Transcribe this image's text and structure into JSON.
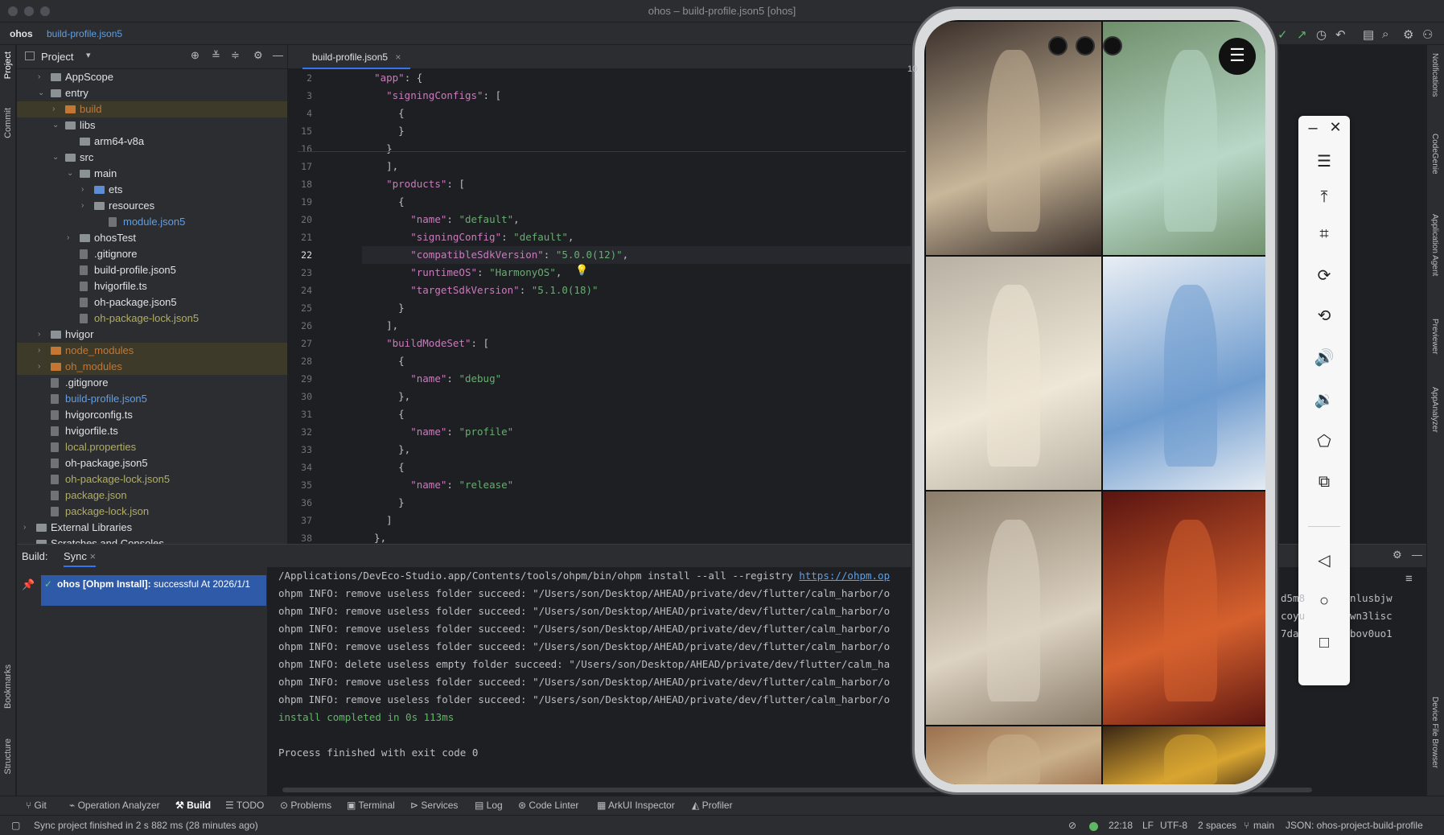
{
  "window": {
    "title": "ohos – build-profile.json5 [ohos]"
  },
  "nav": {
    "project": "ohos",
    "file": "build-profile.json5"
  },
  "project_panel": {
    "title": "Project",
    "tree": [
      {
        "label": "AppScope",
        "type": "folder",
        "depth": 1,
        "arrow": "›",
        "color": "def"
      },
      {
        "label": "entry",
        "type": "folder",
        "depth": 1,
        "arrow": "⌄",
        "color": "def"
      },
      {
        "label": "build",
        "type": "folder-orange",
        "depth": 2,
        "arrow": "›",
        "color": "orange",
        "hl": true
      },
      {
        "label": "libs",
        "type": "folder",
        "depth": 2,
        "arrow": "⌄",
        "color": "def"
      },
      {
        "label": "arm64-v8a",
        "type": "folder",
        "depth": 3,
        "arrow": "",
        "color": "def"
      },
      {
        "label": "src",
        "type": "folder",
        "depth": 2,
        "arrow": "⌄",
        "color": "def"
      },
      {
        "label": "main",
        "type": "folder",
        "depth": 3,
        "arrow": "⌄",
        "color": "def"
      },
      {
        "label": "ets",
        "type": "folder-blue",
        "depth": 4,
        "arrow": "›",
        "color": "def"
      },
      {
        "label": "resources",
        "type": "folder",
        "depth": 4,
        "arrow": "›",
        "color": "def"
      },
      {
        "label": "module.json5",
        "type": "file",
        "depth": 5,
        "arrow": "",
        "color": "blue"
      },
      {
        "label": "ohosTest",
        "type": "folder",
        "depth": 3,
        "arrow": "›",
        "color": "def"
      },
      {
        "label": ".gitignore",
        "type": "file",
        "depth": 3,
        "arrow": "",
        "color": "def"
      },
      {
        "label": "build-profile.json5",
        "type": "file",
        "depth": 3,
        "arrow": "",
        "color": "def"
      },
      {
        "label": "hvigorfile.ts",
        "type": "file",
        "depth": 3,
        "arrow": "",
        "color": "def"
      },
      {
        "label": "oh-package.json5",
        "type": "file",
        "depth": 3,
        "arrow": "",
        "color": "def"
      },
      {
        "label": "oh-package-lock.json5",
        "type": "file",
        "depth": 3,
        "arrow": "",
        "color": "yellow"
      },
      {
        "label": "hvigor",
        "type": "folder",
        "depth": 1,
        "arrow": "›",
        "color": "def"
      },
      {
        "label": "node_modules",
        "type": "folder-orange",
        "depth": 1,
        "arrow": "›",
        "color": "orange",
        "hl": true
      },
      {
        "label": "oh_modules",
        "type": "folder-orange",
        "depth": 1,
        "arrow": "›",
        "color": "orange",
        "hl": true
      },
      {
        "label": ".gitignore",
        "type": "file",
        "depth": 1,
        "arrow": "",
        "color": "def"
      },
      {
        "label": "build-profile.json5",
        "type": "file",
        "depth": 1,
        "arrow": "",
        "color": "blue"
      },
      {
        "label": "hvigorconfig.ts",
        "type": "file",
        "depth": 1,
        "arrow": "",
        "color": "def"
      },
      {
        "label": "hvigorfile.ts",
        "type": "file",
        "depth": 1,
        "arrow": "",
        "color": "def"
      },
      {
        "label": "local.properties",
        "type": "file",
        "depth": 1,
        "arrow": "",
        "color": "yellow"
      },
      {
        "label": "oh-package.json5",
        "type": "file",
        "depth": 1,
        "arrow": "",
        "color": "def"
      },
      {
        "label": "oh-package-lock.json5",
        "type": "file",
        "depth": 1,
        "arrow": "",
        "color": "yellow"
      },
      {
        "label": "package.json",
        "type": "file",
        "depth": 1,
        "arrow": "",
        "color": "yellow"
      },
      {
        "label": "package-lock.json",
        "type": "file",
        "depth": 1,
        "arrow": "",
        "color": "yellow"
      },
      {
        "label": "External Libraries",
        "type": "lib",
        "depth": 0,
        "arrow": "›",
        "color": "def"
      },
      {
        "label": "Scratches and Consoles",
        "type": "lib",
        "depth": 0,
        "arrow": "",
        "color": "def"
      }
    ]
  },
  "editor": {
    "tab": "build-profile.json5",
    "problems": "10",
    "lines": [
      {
        "n": "2",
        "t": "  \"app\": {"
      },
      {
        "n": "3",
        "t": "    \"signingConfigs\": ["
      },
      {
        "n": "4",
        "t": "      {"
      },
      {
        "n": "15",
        "t": "      }"
      },
      {
        "n": "16",
        "t": "    }"
      },
      {
        "n": "17",
        "t": "    ],"
      },
      {
        "n": "18",
        "t": "    \"products\": ["
      },
      {
        "n": "19",
        "t": "      {"
      },
      {
        "n": "20",
        "t": "        \"name\": \"default\","
      },
      {
        "n": "21",
        "t": "        \"signingConfig\": \"default\","
      },
      {
        "n": "22",
        "t": "        \"compatibleSdkVersion\": \"5.0.0(12)\","
      },
      {
        "n": "23",
        "t": "        \"runtimeOS\": \"HarmonyOS\","
      },
      {
        "n": "24",
        "t": "        \"targetSdkVersion\": \"5.1.0(18)\""
      },
      {
        "n": "25",
        "t": "      }"
      },
      {
        "n": "26",
        "t": "    ],"
      },
      {
        "n": "27",
        "t": "    \"buildModeSet\": ["
      },
      {
        "n": "28",
        "t": "      {"
      },
      {
        "n": "29",
        "t": "        \"name\": \"debug\""
      },
      {
        "n": "30",
        "t": "      },"
      },
      {
        "n": "31",
        "t": "      {"
      },
      {
        "n": "32",
        "t": "        \"name\": \"profile\""
      },
      {
        "n": "33",
        "t": "      },"
      },
      {
        "n": "34",
        "t": "      {"
      },
      {
        "n": "35",
        "t": "        \"name\": \"release\""
      },
      {
        "n": "36",
        "t": "      }"
      },
      {
        "n": "37",
        "t": "    ]"
      },
      {
        "n": "38",
        "t": "  },"
      }
    ]
  },
  "build": {
    "label": "Build:",
    "tab": "Sync",
    "entry_bold": "ohos [Ohpm Install]:",
    "entry_rest": "successful At 2026/1/1",
    "console_cmd": "/Applications/DevEco-Studio.app/Contents/tools/ohpm/bin/ohpm install --all --registry ",
    "console_link": "https://ohpm.op",
    "console": [
      "ohpm INFO: remove useless folder succeed: \"/Users/son/Desktop/AHEAD/private/dev/flutter/calm_harbor/o",
      "ohpm INFO: remove useless folder succeed: \"/Users/son/Desktop/AHEAD/private/dev/flutter/calm_harbor/o",
      "ohpm INFO: remove useless folder succeed: \"/Users/son/Desktop/AHEAD/private/dev/flutter/calm_harbor/o",
      "ohpm INFO: remove useless folder succeed: \"/Users/son/Desktop/AHEAD/private/dev/flutter/calm_harbor/o",
      "ohpm INFO: delete useless empty folder succeed: \"/Users/son/Desktop/AHEAD/private/dev/flutter/calm_ha",
      "ohpm INFO: remove useless folder succeed: \"/Users/son/Desktop/AHEAD/private/dev/flutter/calm_harbor/o",
      "ohpm INFO: remove useless folder succeed: \"/Users/son/Desktop/AHEAD/private/dev/flutter/calm_harbor/o"
    ],
    "install_done": "install completed in 0s 113ms",
    "exit": "Process finished with exit code 0",
    "right_fragments": [
      "d5m8",
      "nlusbjw",
      "coyu",
      "wn3lisc",
      "7da",
      "bov0uo1"
    ]
  },
  "bottom_tabs": [
    "Git",
    "Operation Analyzer",
    "Build",
    "TODO",
    "Problems",
    "Terminal",
    "Services",
    "Log",
    "Code Linter",
    "ArkUI Inspector",
    "Profiler"
  ],
  "status": {
    "message": "Sync project finished in 2 s 882 ms (28 minutes ago)",
    "time": "22:18",
    "eol": "LF",
    "encoding": "UTF-8",
    "indent": "2 spaces",
    "branch": "main",
    "schema": "JSON: ohos-project-build-profile"
  },
  "left_tools": [
    "Project",
    "Commit",
    "Bookmarks",
    "Structure"
  ],
  "right_tools": [
    "Notifications",
    "CodeGenie",
    "Application Agent",
    "Previewer",
    "AppAnalyzer",
    "Device File Browser"
  ],
  "emulator": {
    "buttons": [
      "minimize-icon",
      "close-icon",
      "menu-icon",
      "pin-top-icon",
      "screenshot-crop-icon",
      "rotate-icon",
      "rotate-alt-icon",
      "volume-up-icon",
      "volume-down-icon",
      "shake-icon",
      "multi-device-icon",
      "back-icon",
      "home-icon",
      "recents-icon"
    ],
    "photos": [
      {
        "name": "photo-woman-black-hanfu",
        "c1": "#3a2f2a",
        "c2": "#c9b79a"
      },
      {
        "name": "photo-woman-green-hanfu",
        "c1": "#6f8f6b",
        "c2": "#b9d8c8"
      },
      {
        "name": "photo-woman-parasol",
        "c1": "#b8b0a2",
        "c2": "#eee6d6"
      },
      {
        "name": "photo-blue-dress-sketch",
        "c1": "#e9eef4",
        "c2": "#6f9ccf"
      },
      {
        "name": "photo-woman-fan-seated",
        "c1": "#8a7c69",
        "c2": "#ddd3c2"
      },
      {
        "name": "photo-woman-red-hanfu",
        "c1": "#5a1410",
        "c2": "#d6612e"
      },
      {
        "name": "photo-palace-gate",
        "c1": "#9b6f4e",
        "c2": "#c9b08a"
      },
      {
        "name": "photo-woman-golden-crown",
        "c1": "#3a2614",
        "c2": "#d9a531"
      }
    ]
  }
}
